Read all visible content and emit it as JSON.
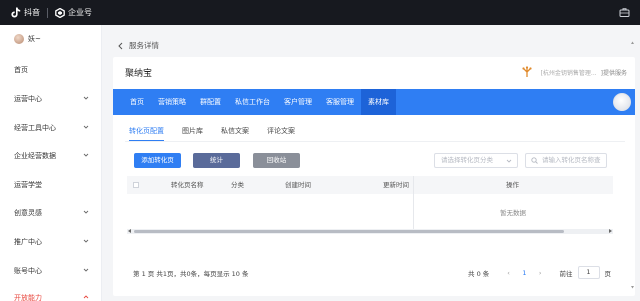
{
  "topbar": {
    "brand_name": "抖音",
    "enterprise_name": "企业号"
  },
  "sidebar": {
    "user_name": "妖~",
    "items": [
      {
        "label": "首页",
        "has_chevron": false
      },
      {
        "label": "运营中心",
        "has_chevron": true
      },
      {
        "label": "经营工具中心",
        "has_chevron": true
      },
      {
        "label": "企业经营数据",
        "has_chevron": true
      },
      {
        "label": "运营学堂",
        "has_chevron": false
      },
      {
        "label": "创意灵感",
        "has_chevron": true
      },
      {
        "label": "推广中心",
        "has_chevron": true
      },
      {
        "label": "账号中心",
        "has_chevron": true
      },
      {
        "label": "开放能力",
        "has_chevron": true
      }
    ]
  },
  "breadcrumb": {
    "label": "服务详情"
  },
  "app": {
    "title": "聚纳宝",
    "provider_name": "[杭州金钥销售管理...",
    "provider_suffix": "]提供服务"
  },
  "main_tabs": [
    "首页",
    "营销策略",
    "群配置",
    "私信工作台",
    "客户管理",
    "客服管理",
    "素材库"
  ],
  "active_main_tab": 6,
  "sub_tabs": [
    "转化页配置",
    "图片库",
    "私信文案",
    "评论文案"
  ],
  "active_sub_tab": 0,
  "buttons": {
    "add": "添加转化页",
    "stats": "统计",
    "recycle": "回收站"
  },
  "filter": {
    "select_placeholder": "请选择转化页分类",
    "search_placeholder": "请输入转化页名称查"
  },
  "table": {
    "columns": [
      "转化页名称",
      "分类",
      "创建时间",
      "更新时间",
      "操作"
    ],
    "empty_text": "暂无数据"
  },
  "pagination": {
    "info": "第 1 页 共1页，共0条，每页显示 10 条",
    "total": "共 0 条",
    "current_page": "1",
    "goto_label": "前往",
    "page_input": "1",
    "page_suffix": "页"
  },
  "colors": {
    "accent": "#2f7ef3",
    "topbar": "#17191f",
    "active_nav": "#e8453c"
  }
}
